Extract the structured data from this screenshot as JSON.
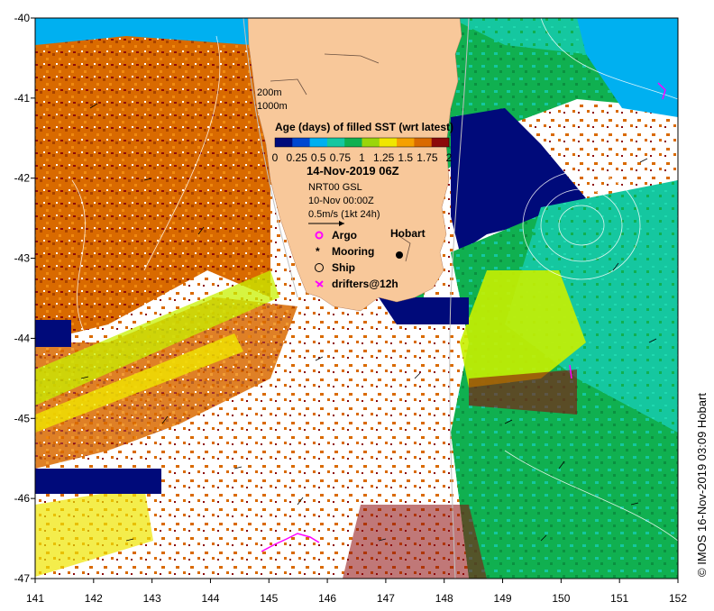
{
  "map": {
    "colorbar_title": "Age (days) of filled SST (wrt latest)",
    "colorbar_ticks": [
      "0",
      "0.25",
      "0.5",
      "0.75",
      "1",
      "1.25",
      "1.5",
      "1.75",
      "2"
    ],
    "colorbar_colors": [
      "#000a7a",
      "#0047d1",
      "#00b0f0",
      "#15c7a0",
      "#10b050",
      "#9ad60a",
      "#f0e600",
      "#f5a000",
      "#d96a00",
      "#8c0a0a"
    ],
    "date_title": "14-Nov-2019 06Z",
    "product_label": "NRT00 GSL",
    "altimetry_label": "10-Nov 00:00Z",
    "vector_scale_label": "0.5m/s (1kt 24h)",
    "isobath_labels": [
      "200m",
      "1000m"
    ],
    "place_label": "Hobart",
    "legend": [
      {
        "label": "Argo",
        "symbol": "argo"
      },
      {
        "label": "Mooring",
        "symbol": "mooring"
      },
      {
        "label": "Ship",
        "symbol": "ship"
      },
      {
        "label": "drifters@12h",
        "symbol": "drifter"
      }
    ],
    "x_ticks": [
      "141",
      "142",
      "143",
      "144",
      "145",
      "146",
      "147",
      "148",
      "149",
      "150",
      "151",
      "152"
    ],
    "y_ticks": [
      "-40",
      "-41",
      "-42",
      "-43",
      "-44",
      "-45",
      "-46",
      "-47"
    ],
    "credit": "© IMOS 16-Nov-2019 03:09 Hobart",
    "colors": {
      "land": "#f8c89a",
      "orange": "#d96a00",
      "green": "#10b050",
      "teal": "#15c7a0",
      "navy": "#000a7a",
      "lightblue": "#00b0f0",
      "lime": "#c8f000",
      "yellow": "#f0e600",
      "darkred": "#8c0a0a",
      "magenta": "#ff00ff"
    }
  }
}
